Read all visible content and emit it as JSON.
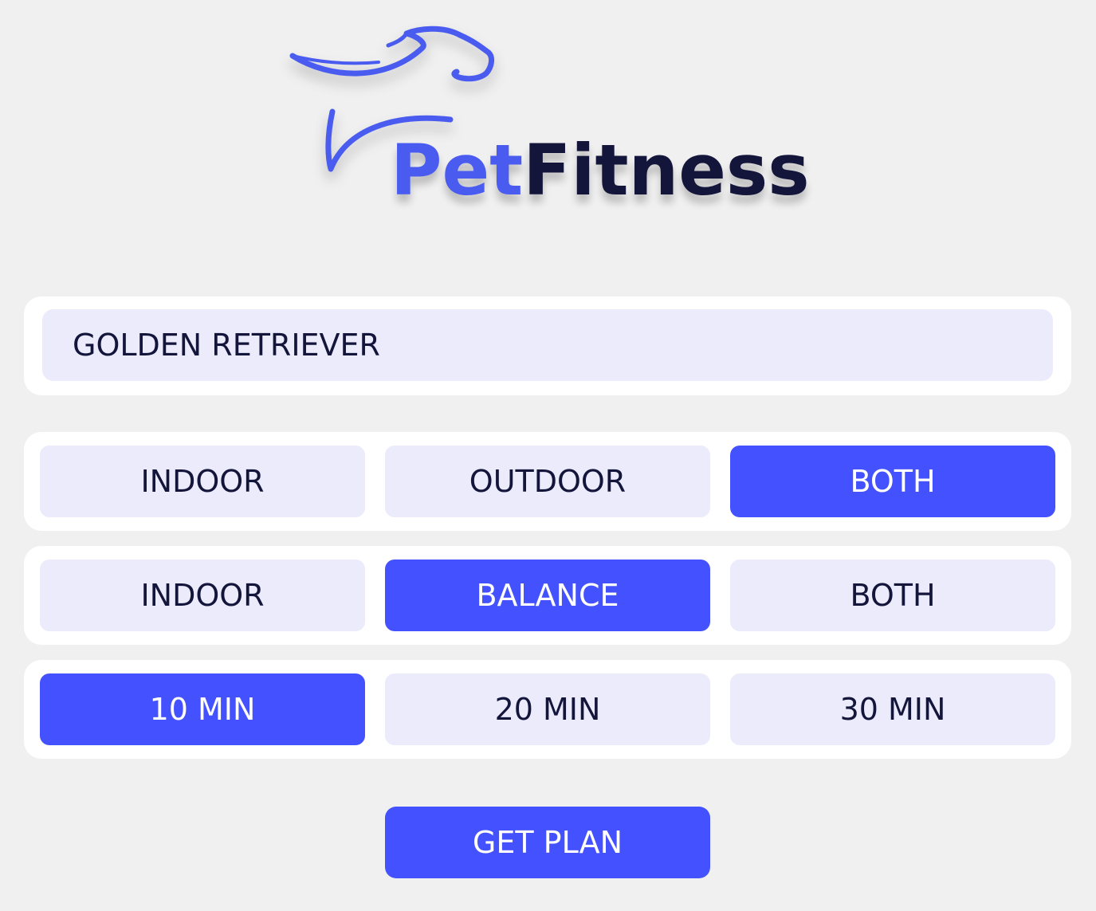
{
  "brand": {
    "logo_icon": "dog-outline-icon",
    "name_part1": "Pet",
    "name_part2": "Fitness",
    "colors": {
      "pet": "#4a5cf0",
      "fitness": "#14153a"
    }
  },
  "breed": {
    "value": "GOLDEN RETRIEVER"
  },
  "option_rows": [
    {
      "options": [
        "INDOOR",
        "OUTDOOR",
        "BOTH"
      ],
      "selected": "BOTH"
    },
    {
      "options": [
        "INDOOR",
        "BALANCE",
        "BOTH"
      ],
      "selected": "BALANCE"
    },
    {
      "options": [
        "10 MIN",
        "20 MIN",
        "30 MIN"
      ],
      "selected": "10 MIN"
    }
  ],
  "actions": {
    "get_plan_label": "GET PLAN"
  },
  "colors": {
    "background": "#f0f0f0",
    "card": "#ffffff",
    "option": "#ebebfc",
    "accent": "#4451fe",
    "text": "#14153a"
  }
}
